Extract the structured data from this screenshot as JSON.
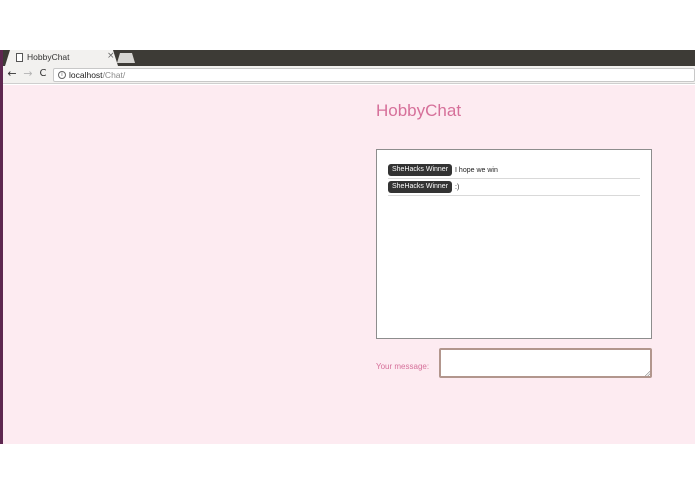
{
  "browser": {
    "tab": {
      "title": "HobbyChat",
      "close_glyph": "×"
    },
    "toolbar": {
      "back_glyph": "←",
      "forward_glyph": "→",
      "reload_glyph": "C",
      "info_glyph": "i",
      "url_host": "localhost",
      "url_path": "/Chat/"
    }
  },
  "app": {
    "title": "HobbyChat",
    "messages": [
      {
        "user": "SheHacks Winner",
        "text": "I hope we win"
      },
      {
        "user": "SheHacks Winner",
        "text": ":)"
      }
    ],
    "input": {
      "label": "Your message:",
      "value": ""
    }
  },
  "icons": [
    "page-icon",
    "close-icon",
    "back-arrow-icon",
    "forward-arrow-icon",
    "reload-icon",
    "info-icon",
    "resize-grip-icon"
  ],
  "colors": {
    "page_bg": "#fdebf1",
    "accent": "#d6709a",
    "badge_bg": "#333333",
    "tabstrip": "#3d3b36"
  }
}
